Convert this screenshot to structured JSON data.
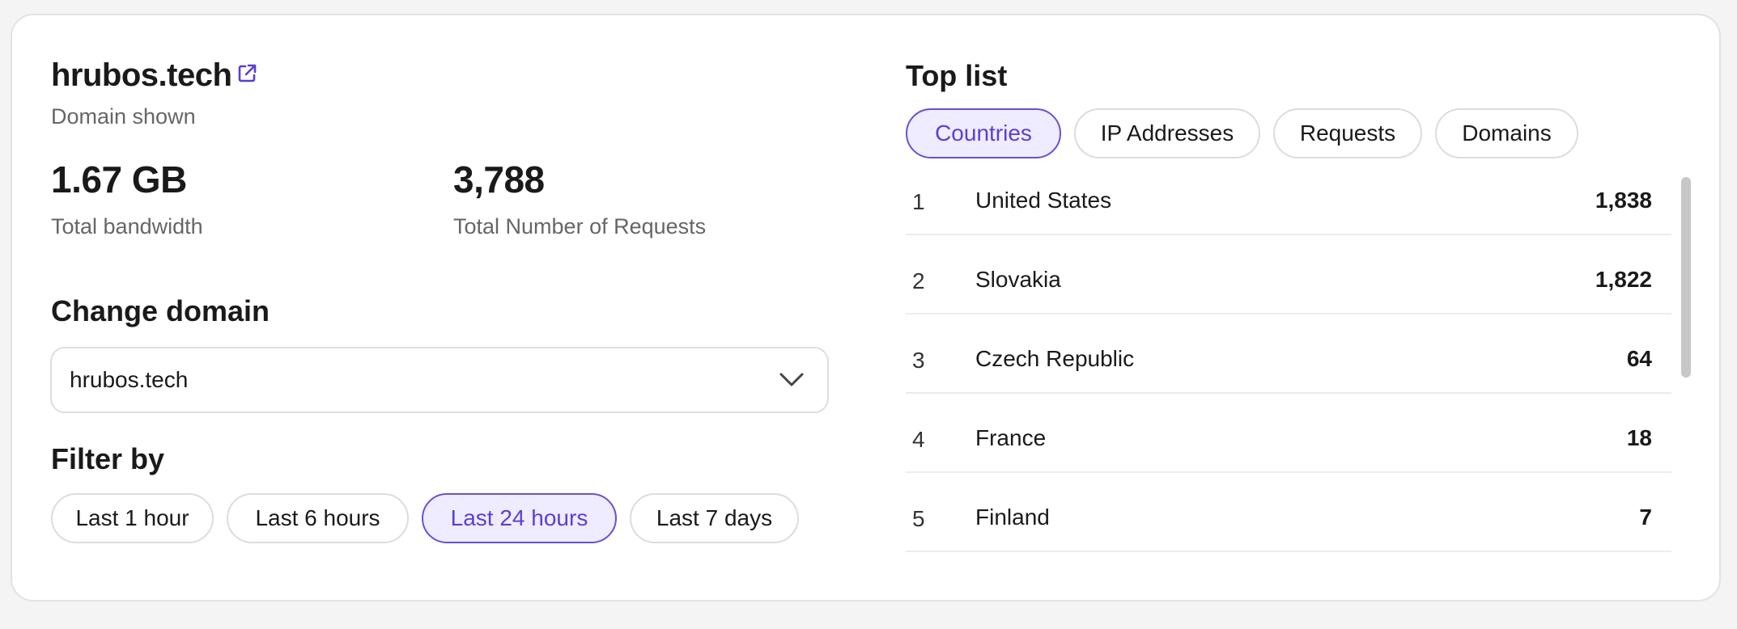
{
  "domain": {
    "name": "hrubos.tech",
    "subtitle": "Domain shown",
    "external_link_icon": "external-link-icon"
  },
  "stats": {
    "bandwidth_value": "1.67 GB",
    "bandwidth_label": "Total bandwidth",
    "requests_value": "3,788",
    "requests_label": "Total Number of Requests"
  },
  "change_domain": {
    "title": "Change domain",
    "selected": "hrubos.tech",
    "icon": "chevron-down-icon"
  },
  "filter": {
    "title": "Filter by",
    "options": [
      "Last 1 hour",
      "Last 6 hours",
      "Last 24 hours",
      "Last 7 days"
    ],
    "active": "Last 24 hours"
  },
  "top_list": {
    "title": "Top list",
    "tabs": [
      "Countries",
      "IP Addresses",
      "Requests",
      "Domains"
    ],
    "active_tab": "Countries",
    "rows": [
      {
        "rank": "1",
        "name": "United States",
        "count": "1,838"
      },
      {
        "rank": "2",
        "name": "Slovakia",
        "count": "1,822"
      },
      {
        "rank": "3",
        "name": "Czech Republic",
        "count": "64"
      },
      {
        "rank": "4",
        "name": "France",
        "count": "18"
      },
      {
        "rank": "5",
        "name": "Finland",
        "count": "7"
      }
    ]
  },
  "colors": {
    "accent": "#5b3fd0",
    "accent_bg": "#efecff",
    "border": "#dcdcdc"
  }
}
